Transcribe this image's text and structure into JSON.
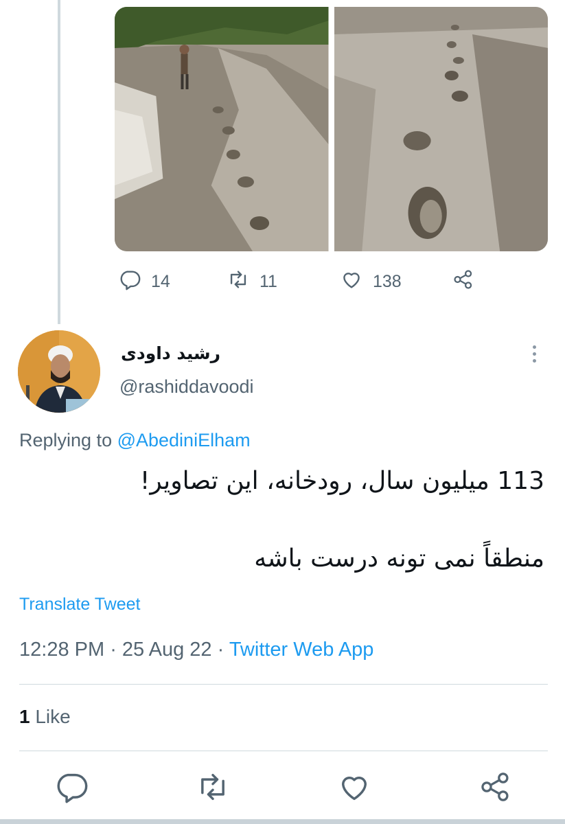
{
  "parent_tweet": {
    "reply_count": "14",
    "retweet_count": "11",
    "like_count": "138"
  },
  "tweet": {
    "display_name": "رشید داودی",
    "handle": "@rashiddavoodi",
    "replying_prefix": "Replying to ",
    "replying_to": "@AbediniElham",
    "text_line1": "113 میلیون سال، رودخانه، این تصاویر!",
    "text_line2": "منطقاً نمی تونه درست باشه",
    "translate_label": "Translate Tweet",
    "time": "12:28 PM",
    "separator": " · ",
    "date": "25 Aug 22",
    "source": "Twitter Web App",
    "like_count": "1",
    "like_label": " Like"
  },
  "colors": {
    "accent": "#1d9bf0",
    "secondary_text": "#536471",
    "primary_text": "#0f1419",
    "border": "#cfd9de"
  },
  "icons": [
    "reply-icon",
    "retweet-icon",
    "like-icon",
    "share-icon",
    "more-icon"
  ]
}
